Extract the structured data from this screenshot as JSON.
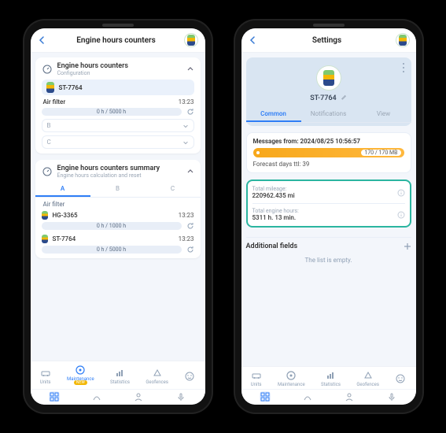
{
  "phone1": {
    "header": {
      "title": "Engine hours counters"
    },
    "card1": {
      "title": "Engine hours counters",
      "subtitle": "Configuration",
      "unit": "ST-7764",
      "counter_name": "Air filter",
      "counter_time": "13:23",
      "bar_text": "0 h / 5000 h",
      "collapsed": [
        "B",
        "C"
      ]
    },
    "card2": {
      "title": "Engine hours counters summary",
      "subtitle": "Engine hours calculation and reset",
      "tabs": [
        "A",
        "B",
        "C"
      ],
      "section": "Air filter",
      "rows": [
        {
          "unit": "HG-3365",
          "time": "13:23",
          "bar": "0 h / 1000 h"
        },
        {
          "unit": "ST-7764",
          "time": "13:23",
          "bar": "0 h / 5000 h"
        }
      ]
    },
    "nav": {
      "items": [
        "Units",
        "Maintenance",
        "Statistics",
        "Geofences"
      ],
      "badge": "NEW"
    }
  },
  "phone2": {
    "header": {
      "title": "Settings"
    },
    "profile": {
      "name": "ST-7764"
    },
    "tabs": [
      "Common",
      "Notifications",
      "View"
    ],
    "messages": {
      "head": "Messages from: 2024/08/25 10:56:57",
      "pill": "170 / 170 MB",
      "forecast": "Forecast days ttl: 39"
    },
    "totals": {
      "mileage_label": "Total mileage:",
      "mileage_value": "220962.435 mi",
      "hours_label": "Total engine hours:",
      "hours_value": "5311 h. 13 min."
    },
    "additional": {
      "title": "Additional fields",
      "empty": "The list is empty."
    },
    "nav": {
      "items": [
        "Units",
        "Maintenance",
        "Statistics",
        "Geofences"
      ]
    }
  }
}
